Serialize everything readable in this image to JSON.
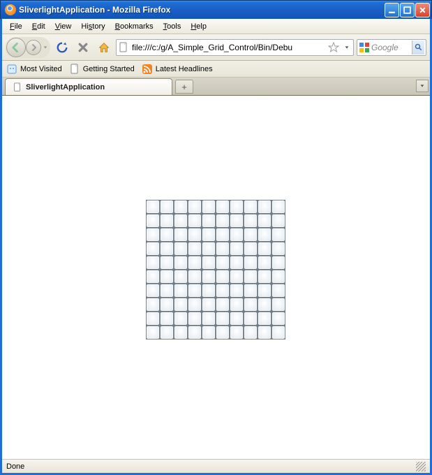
{
  "window": {
    "title": "SliverlightApplication - Mozilla Firefox"
  },
  "menu": {
    "items": [
      "File",
      "Edit",
      "View",
      "History",
      "Bookmarks",
      "Tools",
      "Help"
    ]
  },
  "nav": {
    "url": "file:///c:/g/A_Simple_Grid_Control/Bin/Debu"
  },
  "search": {
    "placeholder": "Google"
  },
  "bookmarksBar": {
    "mostVisited": "Most Visited",
    "gettingStarted": "Getting Started",
    "latestHeadlines": "Latest Headlines"
  },
  "tabs": {
    "active": {
      "title": "SliverlightApplication"
    },
    "newTabSymbol": "+"
  },
  "grid": {
    "rows": 10,
    "cols": 10
  },
  "status": {
    "text": "Done"
  }
}
